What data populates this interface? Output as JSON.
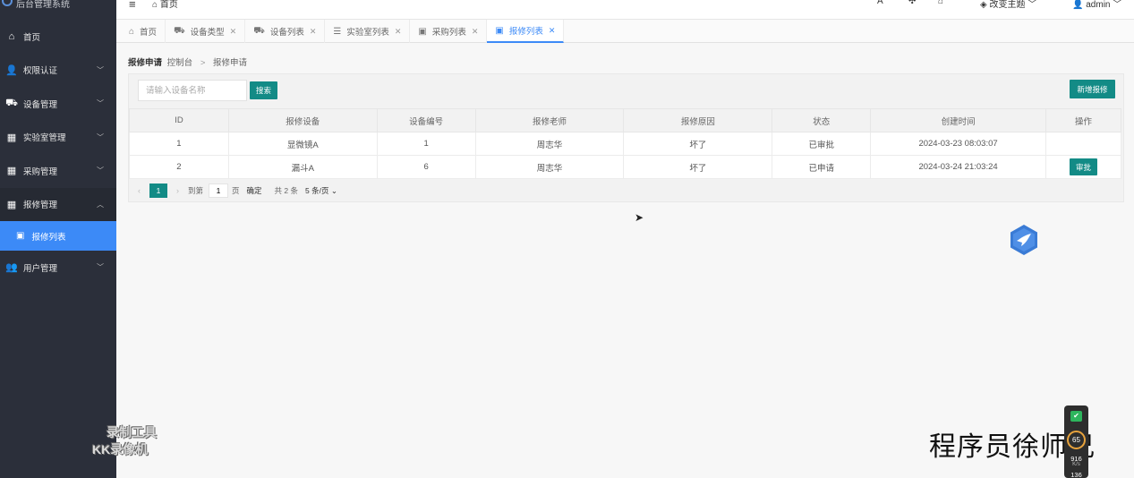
{
  "app": {
    "title": "后台管理系统"
  },
  "topbar": {
    "home": "首页",
    "user": "admin",
    "theme": "改变主题"
  },
  "sidebar": {
    "items": [
      {
        "label": "首页",
        "icon": "home-icon"
      },
      {
        "label": "权限认证",
        "icon": "user-key-icon"
      },
      {
        "label": "设备管理",
        "icon": "car-icon"
      },
      {
        "label": "实验室管理",
        "icon": "grid-icon"
      },
      {
        "label": "采购管理",
        "icon": "grid-icon"
      },
      {
        "label": "报修管理",
        "icon": "grid-icon"
      },
      {
        "label": "用户管理",
        "icon": "users-icon"
      }
    ],
    "subitem": {
      "label": "报修列表",
      "icon": "image-icon"
    }
  },
  "tabs": [
    {
      "label": "首页",
      "icon": "home-icon"
    },
    {
      "label": "设备类型",
      "icon": "car-icon"
    },
    {
      "label": "设备列表",
      "icon": "car-icon"
    },
    {
      "label": "实验室列表",
      "icon": "list-icon"
    },
    {
      "label": "采购列表",
      "icon": "image-icon"
    },
    {
      "label": "报修列表",
      "icon": "image-icon"
    }
  ],
  "breadcrumb": {
    "title": "报修申请",
    "parent": "控制台",
    "sep": ">",
    "current": "报修申请"
  },
  "search": {
    "placeholder": "请输入设备名称",
    "button": "搜索"
  },
  "add_button": "新增报修",
  "table": {
    "headers": [
      "ID",
      "报修设备",
      "设备编号",
      "报修老师",
      "报修原因",
      "状态",
      "创建时间",
      "操作"
    ],
    "rows": [
      [
        "1",
        "显微镜A",
        "1",
        "周志华",
        "坏了",
        "已审批",
        "2024-03-23 08:03:07",
        ""
      ],
      [
        "2",
        "漏斗A",
        "6",
        "周志华",
        "坏了",
        "已申请",
        "2024-03-24 21:03:24",
        "审批"
      ]
    ]
  },
  "pager": {
    "current": "1",
    "goto": "到第",
    "page_input": "1",
    "page_unit": "页",
    "ok": "确定",
    "total": "共 2 条",
    "size": "5 条/页"
  },
  "watermark": {
    "tool_line1": "录制工具",
    "tool_line2": "KK录像机",
    "author": "程序员徐师兄"
  },
  "monitor": {
    "score": "65",
    "speed1": "916",
    "unit": "K/s",
    "speed2": "136"
  },
  "colors": {
    "accent": "#138b86",
    "sidebar": "#2b2f3a",
    "active_blue": "#3c8af7"
  }
}
